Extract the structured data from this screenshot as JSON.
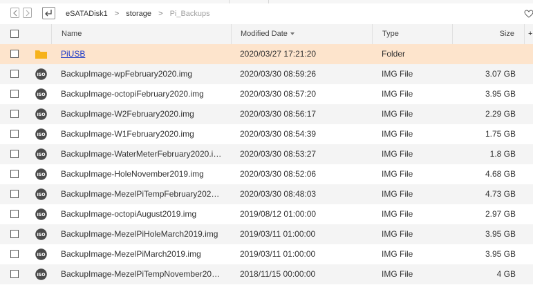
{
  "breadcrumb": [
    "eSATADisk1",
    "storage",
    "Pi_Backups"
  ],
  "columns": {
    "name": "Name",
    "modified": "Modified Date",
    "type": "Type",
    "size": "Size"
  },
  "colors": {
    "selected_row": "#fde4cc",
    "link": "#1c39c7",
    "folder": "#f6b21b",
    "iso_badge": "#4a4a4a"
  },
  "files": [
    {
      "name": "PiUSB",
      "modified": "2020/03/27 17:21:20",
      "type": "Folder",
      "size": "",
      "icon": "folder-icon"
    },
    {
      "name": "BackupImage-wpFebruary2020.img",
      "modified": "2020/03/30 08:59:26",
      "type": "IMG File",
      "size": "3.07 GB",
      "icon": "iso-file-icon"
    },
    {
      "name": "BackupImage-octopiFebruary2020.img",
      "modified": "2020/03/30 08:57:20",
      "type": "IMG File",
      "size": "3.95 GB",
      "icon": "iso-file-icon"
    },
    {
      "name": "BackupImage-W2February2020.img",
      "modified": "2020/03/30 08:56:17",
      "type": "IMG File",
      "size": "2.29 GB",
      "icon": "iso-file-icon"
    },
    {
      "name": "BackupImage-W1February2020.img",
      "modified": "2020/03/30 08:54:39",
      "type": "IMG File",
      "size": "1.75 GB",
      "icon": "iso-file-icon"
    },
    {
      "name": "BackupImage-WaterMeterFebruary2020.i…",
      "modified": "2020/03/30 08:53:27",
      "type": "IMG File",
      "size": "1.8 GB",
      "icon": "iso-file-icon"
    },
    {
      "name": "BackupImage-HoleNovember2019.img",
      "modified": "2020/03/30 08:52:06",
      "type": "IMG File",
      "size": "4.68 GB",
      "icon": "iso-file-icon"
    },
    {
      "name": "BackupImage-MezelPiTempFebruary202…",
      "modified": "2020/03/30 08:48:03",
      "type": "IMG File",
      "size": "4.73 GB",
      "icon": "iso-file-icon"
    },
    {
      "name": "BackupImage-octopiAugust2019.img",
      "modified": "2019/08/12 01:00:00",
      "type": "IMG File",
      "size": "2.97 GB",
      "icon": "iso-file-icon"
    },
    {
      "name": "BackupImage-MezelPiHoleMarch2019.img",
      "modified": "2019/03/11 01:00:00",
      "type": "IMG File",
      "size": "3.95 GB",
      "icon": "iso-file-icon"
    },
    {
      "name": "BackupImage-MezelPiMarch2019.img",
      "modified": "2019/03/11 01:00:00",
      "type": "IMG File",
      "size": "3.95 GB",
      "icon": "iso-file-icon"
    },
    {
      "name": "BackupImage-MezelPiTempNovember20…",
      "modified": "2018/11/15 00:00:00",
      "type": "IMG File",
      "size": "4 GB",
      "icon": "iso-file-icon"
    }
  ]
}
